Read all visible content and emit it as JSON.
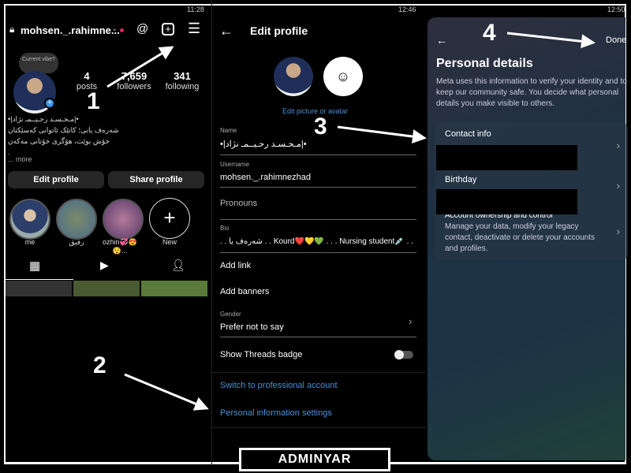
{
  "left": {
    "time": "11:28",
    "username": "mohsen._.rahimne...",
    "note": "Current vibe?",
    "stats": [
      {
        "n": "4",
        "l": "posts"
      },
      {
        "n": "7,659",
        "l": "followers"
      },
      {
        "n": "341",
        "l": "following"
      }
    ],
    "bio": [
      "•|مـحـسـد رحـيــمـ نژاد|•",
      "شەرەف یانی؛ کاتێک ئاتوانی کەسێکتان",
      "خۆش بوێت، هۆگری خۆتانی مەکەن",
      "."
    ],
    "more": "... more",
    "edit": "Edit profile",
    "share": "Share profile",
    "highlights": [
      "me",
      "رفیق",
      "ozhin💞😍😯...",
      "New"
    ]
  },
  "middle": {
    "time": "12:46",
    "title": "Edit profile",
    "edit_pic": "Edit picture or avatar",
    "name_label": "Name",
    "name": "•|مـحـسـد رحـيــمـ نژاد|•",
    "username_label": "Username",
    "username": "mohsen._.rahimnezhad",
    "pronouns": "Pronouns",
    "bio_label": "Bio",
    "bio": ". . شەرەف یا . . Kourd❤️💛💚 . . . Nursing student💉 . .",
    "add_link": "Add link",
    "add_banners": "Add banners",
    "gender_label": "Gender",
    "gender": "Prefer not to say",
    "threads_badge": "Show Threads badge",
    "threads_badge_on": false,
    "switch_pro": "Switch to professional account",
    "personal_info": "Personal information settings"
  },
  "right": {
    "time": "12:50",
    "done": "Done",
    "title": "Personal details",
    "desc": "Meta uses this information to verify your identity and to keep our community safe. You decide what personal details you make visible to others.",
    "contact": "Contact info",
    "birthday": "Birthday",
    "account_title": "Account ownership and control",
    "account_desc": "Manage your data, modify your legacy contact, deactivate or delete your accounts and profiles."
  },
  "steps": [
    "1",
    "2",
    "3",
    "4"
  ],
  "watermark": "ADMINYAR",
  "colors": {
    "link": "#4a8fd6",
    "notification": "#e0245e"
  }
}
